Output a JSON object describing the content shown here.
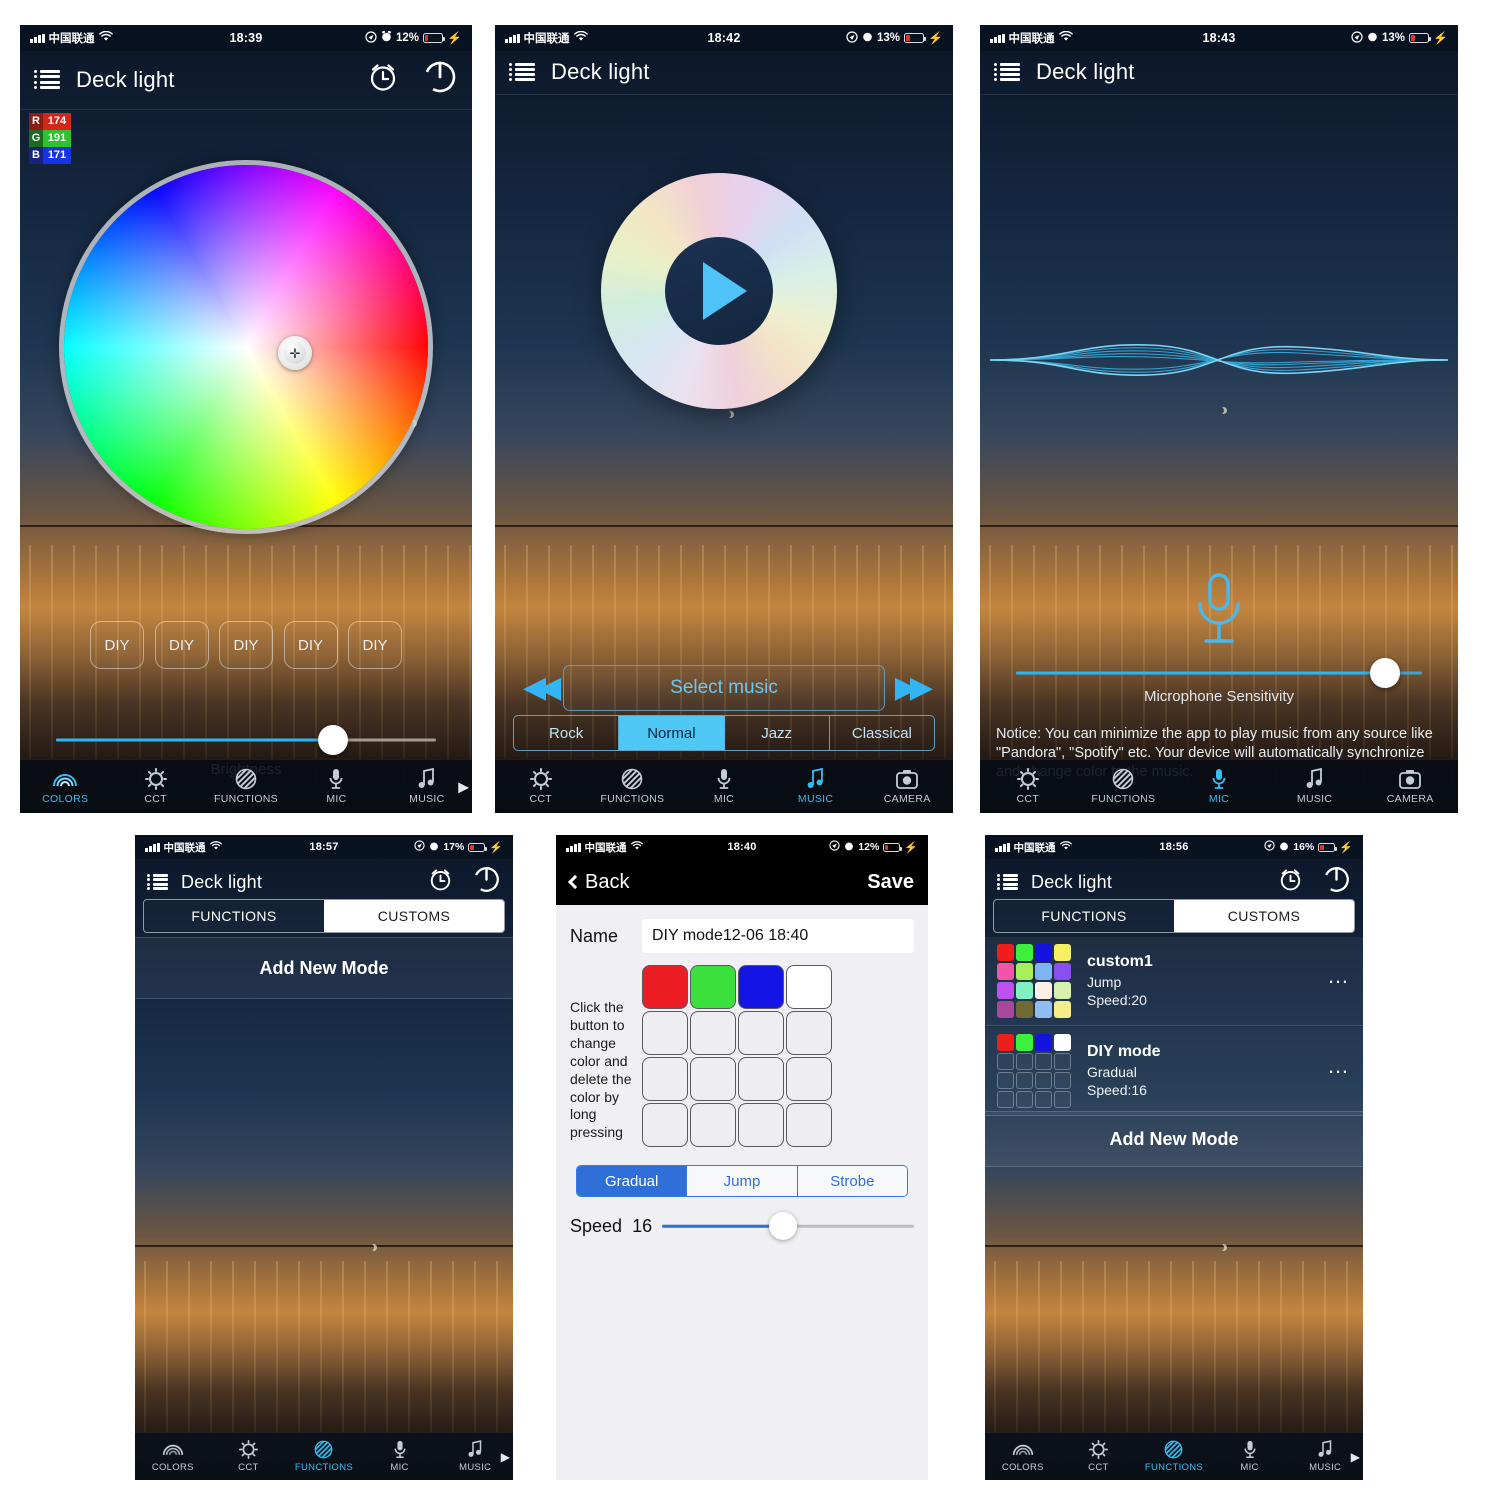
{
  "app": {
    "title": "Deck light"
  },
  "panel_colors": {
    "status": {
      "carrier": "中国联通",
      "time": "18:39",
      "battery": "12%"
    },
    "header": {
      "title": "Deck light"
    },
    "rgb": {
      "r_label": "R",
      "r_value": "174",
      "g_label": "G",
      "g_value": "191",
      "b_label": "B",
      "b_value": "171"
    },
    "diy_buttons": [
      "DIY",
      "DIY",
      "DIY",
      "DIY",
      "DIY"
    ],
    "brightness": {
      "label": "Brightness",
      "percent": 73
    },
    "tabs": [
      {
        "label": "COLORS",
        "icon": "rainbow-icon",
        "active": true
      },
      {
        "label": "CCT",
        "icon": "sun-icon",
        "active": false
      },
      {
        "label": "FUNCTIONS",
        "icon": "hatched-circle-icon",
        "active": false
      },
      {
        "label": "MIC",
        "icon": "microphone-icon",
        "active": false
      },
      {
        "label": "MUSIC",
        "icon": "music-note-icon",
        "active": false
      }
    ]
  },
  "panel_music": {
    "status": {
      "carrier": "中国联通",
      "time": "18:42",
      "battery": "13%"
    },
    "header": {
      "title": "Deck light"
    },
    "play_button": "play-icon",
    "select_music_label": "Select music",
    "prev_label": "rewind-icon",
    "next_label": "fast-forward-icon",
    "genres": [
      {
        "label": "Rock",
        "active": false
      },
      {
        "label": "Normal",
        "active": true
      },
      {
        "label": "Jazz",
        "active": false
      },
      {
        "label": "Classical",
        "active": false
      }
    ],
    "tabs": [
      {
        "label": "CCT",
        "icon": "sun-icon",
        "active": false
      },
      {
        "label": "FUNCTIONS",
        "icon": "hatched-circle-icon",
        "active": false
      },
      {
        "label": "MIC",
        "icon": "microphone-icon",
        "active": false
      },
      {
        "label": "MUSIC",
        "icon": "music-note-icon",
        "active": true
      },
      {
        "label": "CAMERA",
        "icon": "camera-icon",
        "active": false
      }
    ]
  },
  "panel_mic": {
    "status": {
      "carrier": "中国联通",
      "time": "18:43",
      "battery": "13%"
    },
    "header": {
      "title": "Deck light"
    },
    "sensitivity": {
      "label": "Microphone Sensitivity",
      "percent": 91
    },
    "notice": "Notice: You can minimize the app to play music from any source like \"Pandora\", \"Spotify\" etc. Your device will automatically synchronize and change color to the music.",
    "tabs": [
      {
        "label": "CCT",
        "icon": "sun-icon",
        "active": false
      },
      {
        "label": "FUNCTIONS",
        "icon": "hatched-circle-icon",
        "active": false
      },
      {
        "label": "MIC",
        "icon": "microphone-icon",
        "active": true
      },
      {
        "label": "MUSIC",
        "icon": "music-note-icon",
        "active": false
      },
      {
        "label": "CAMERA",
        "icon": "camera-icon",
        "active": false
      }
    ]
  },
  "panel_customs_empty": {
    "status": {
      "carrier": "中国联通",
      "time": "18:57",
      "battery": "17%"
    },
    "header": {
      "title": "Deck light"
    },
    "segtabs": [
      {
        "label": "FUNCTIONS",
        "active": false
      },
      {
        "label": "CUSTOMS",
        "active": true
      }
    ],
    "add_new_mode": "Add New Mode",
    "tabs": [
      {
        "label": "COLORS",
        "icon": "rainbow-icon",
        "active": false
      },
      {
        "label": "CCT",
        "icon": "sun-icon",
        "active": false
      },
      {
        "label": "FUNCTIONS",
        "icon": "hatched-circle-icon",
        "active": true
      },
      {
        "label": "MIC",
        "icon": "microphone-icon",
        "active": false
      },
      {
        "label": "MUSIC",
        "icon": "music-note-icon",
        "active": false
      }
    ]
  },
  "panel_editor": {
    "status": {
      "carrier": "中国联通",
      "time": "18:40",
      "battery": "12%"
    },
    "back_label": "Back",
    "save_label": "Save",
    "name_label": "Name",
    "name_value": "DIY mode12-06 18:40",
    "hint": "Click the button to change color and delete the color by long pressing",
    "grid_colors": [
      "#ec1c24",
      "#3ce03c",
      "#1414e6",
      "#ffffff",
      "",
      "",
      "",
      "",
      "",
      "",
      "",
      "",
      "",
      "",
      "",
      ""
    ],
    "effects": [
      {
        "label": "Gradual",
        "active": true
      },
      {
        "label": "Jump",
        "active": false
      },
      {
        "label": "Strobe",
        "active": false
      }
    ],
    "speed": {
      "label": "Speed",
      "value": "16",
      "percent": 48
    }
  },
  "panel_customs_list": {
    "status": {
      "carrier": "中国联通",
      "time": "18:56",
      "battery": "16%"
    },
    "header": {
      "title": "Deck light"
    },
    "segtabs": [
      {
        "label": "FUNCTIONS",
        "active": false
      },
      {
        "label": "CUSTOMS",
        "active": true
      }
    ],
    "modes": [
      {
        "name": "custom1",
        "effect": "Jump",
        "speed": "Speed:20",
        "menu": "…",
        "colors": [
          "#f01d1d",
          "#3ef03e",
          "#1414e0",
          "#f5ef62",
          "#f255a8",
          "#a6ef5e",
          "#7fb4f2",
          "#8a4ff0",
          "#c04ff0",
          "#82f0c0",
          "#fdeee6",
          "#d8f0ae",
          "#a8489c",
          "#6f6a35",
          "#8fbdf2",
          "#f5ec8a"
        ]
      },
      {
        "name": "DIY mode",
        "effect": "Gradual",
        "speed": "Speed:16",
        "menu": "…",
        "colors": [
          "#f01d1d",
          "#3ef03e",
          "#1414e0",
          "#ffffff",
          "",
          "",
          "",
          "",
          "",
          "",
          "",
          "",
          "",
          "",
          "",
          ""
        ]
      }
    ],
    "add_new_mode": "Add New Mode",
    "tabs": [
      {
        "label": "COLORS",
        "icon": "rainbow-icon",
        "active": false
      },
      {
        "label": "CCT",
        "icon": "sun-icon",
        "active": false
      },
      {
        "label": "FUNCTIONS",
        "icon": "hatched-circle-icon",
        "active": true
      },
      {
        "label": "MIC",
        "icon": "microphone-icon",
        "active": false
      },
      {
        "label": "MUSIC",
        "icon": "music-note-icon",
        "active": false
      }
    ]
  }
}
